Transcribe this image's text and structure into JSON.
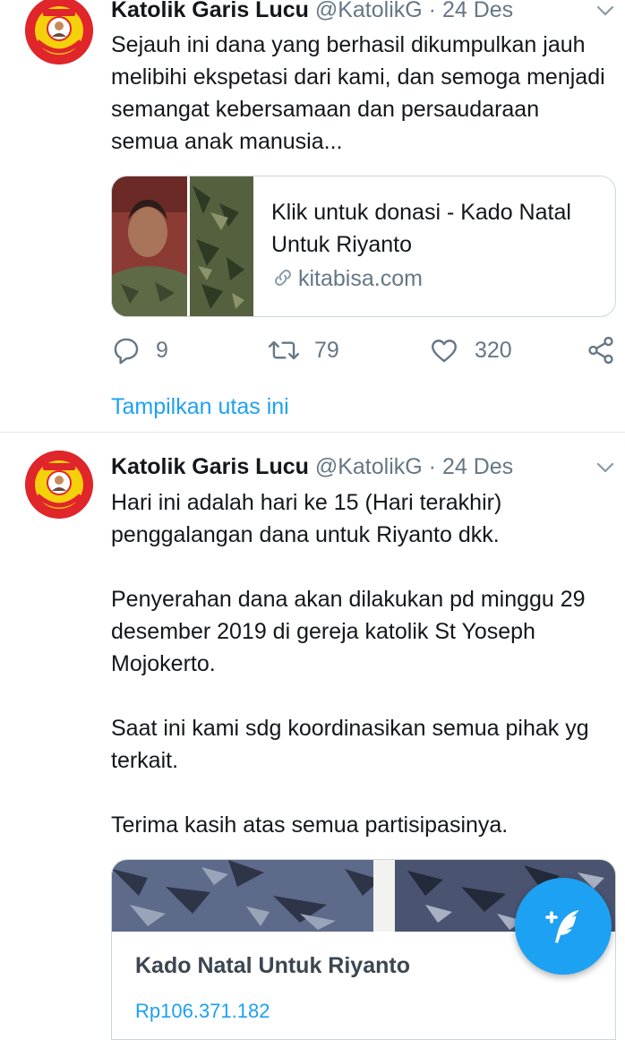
{
  "tweets": [
    {
      "author_name": "Katolik Garis Lucu",
      "author_handle": "@KatolikG",
      "separator": "·",
      "date": "24 Des",
      "text": [
        "Sejauh ini dana yang berhasil dikumpulkan jauh melibihi ekspetasi dari kami, dan semoga menjadi semangat kebersamaan dan persaudaraan semua anak manusia..."
      ],
      "card": {
        "title": "Klik untuk donasi - Kado Natal Untuk Riyanto",
        "domain": "kitabisa.com"
      },
      "counts": {
        "replies": "9",
        "retweets": "79",
        "likes": "320"
      },
      "thread_link": "Tampilkan utas ini"
    },
    {
      "author_name": "Katolik Garis Lucu",
      "author_handle": "@KatolikG",
      "separator": "·",
      "date": "24 Des",
      "text": [
        "Hari ini adalah hari ke 15 (Hari terakhir) penggalangan dana untuk Riyanto dkk.",
        "Penyerahan dana akan dilakukan pd minggu 29 desember 2019 di gereja katolik St Yoseph Mojokerto.",
        "Saat ini kami sdg koordinasikan  semua pihak yg terkait.",
        "Terima kasih atas semua partisipasinya."
      ],
      "card": {
        "title": "Kado Natal Untuk Riyanto",
        "subtitle": "Rp106.371.182"
      }
    }
  ],
  "avatar_lettering": {
    "top": "KATOLIKG",
    "bottom": "Katolik Garis Lucu"
  },
  "icons": {
    "reply": "reply-icon",
    "retweet": "retweet-icon",
    "like": "heart-icon",
    "share": "share-icon",
    "menu": "chevron-down-icon",
    "link": "link-icon",
    "compose": "compose-tweet-icon"
  },
  "colors": {
    "accent": "#1da1f2",
    "text": "#14171a",
    "muted": "#657786",
    "border": "#ccd6dd",
    "avatar_red": "#e0252b",
    "avatar_yellow": "#f5d10c"
  }
}
